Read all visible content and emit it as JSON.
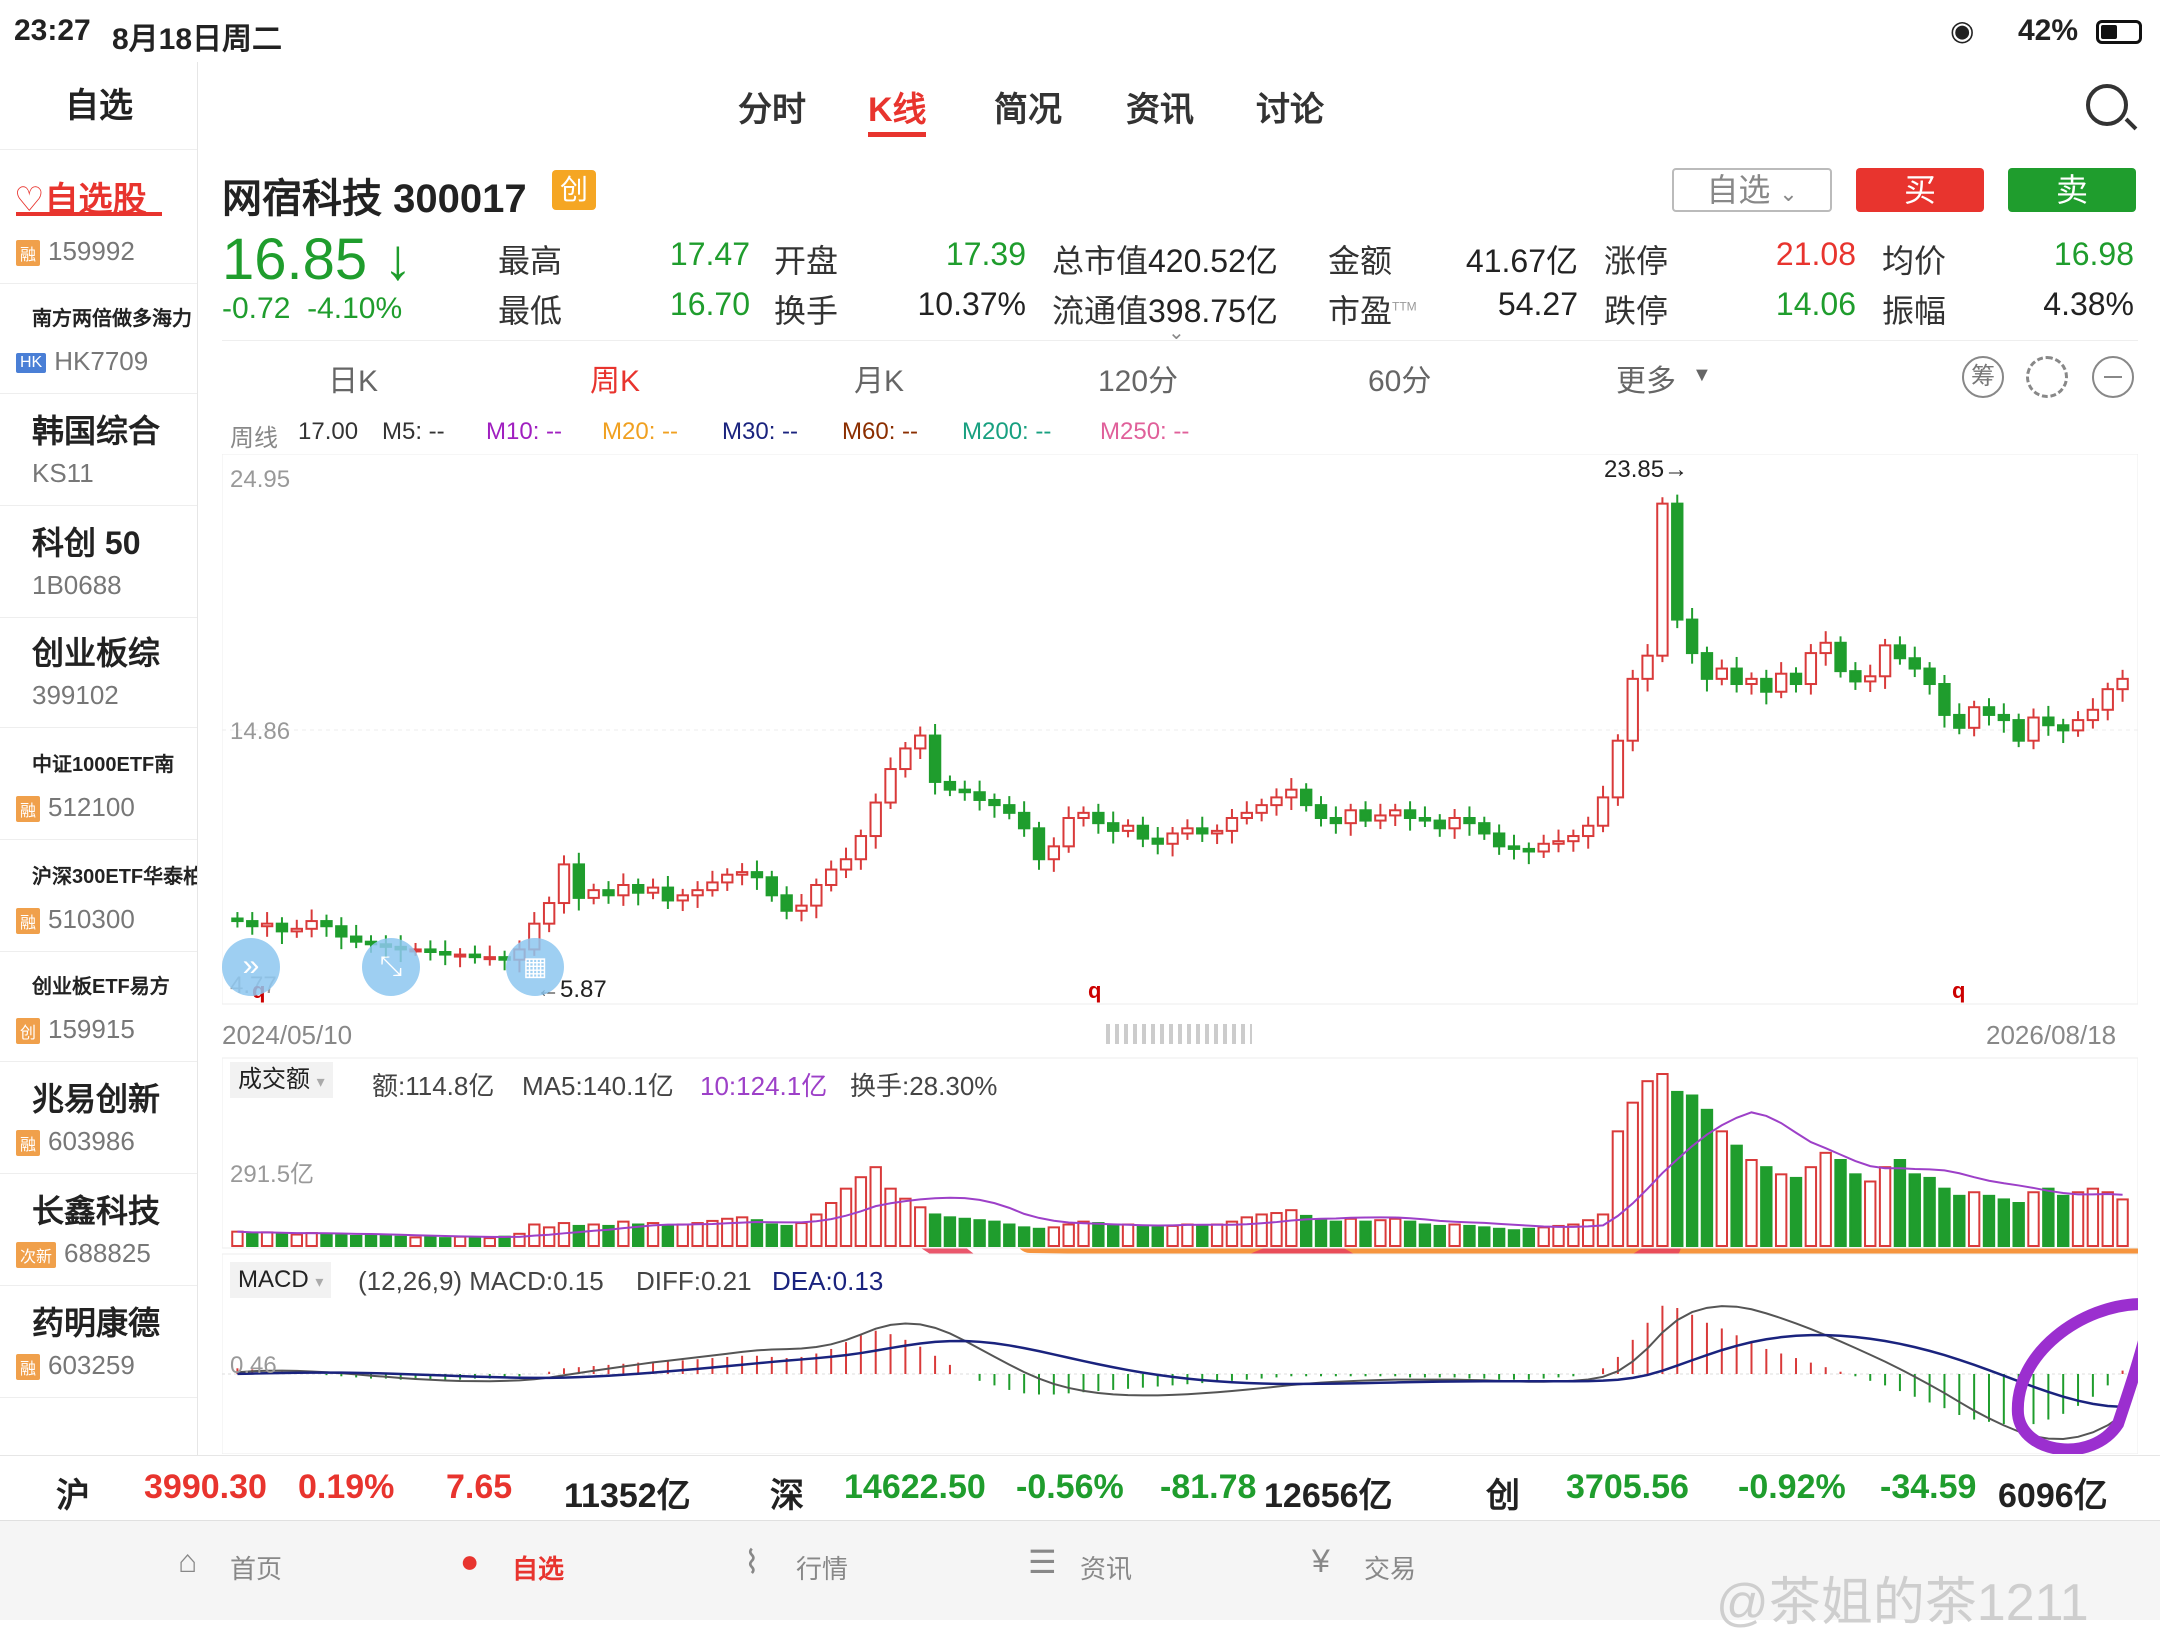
{
  "status": {
    "time": "23:27",
    "date": "8月18日周二",
    "battery": "42%"
  },
  "sidebar": {
    "title": "自选",
    "active": "自选股",
    "items": [
      {
        "name": "",
        "code": "159992",
        "badge": "融",
        "badge_color": "#f0a04b"
      },
      {
        "name": "南方两倍做多海力",
        "code": "HK7709",
        "badge": "HK",
        "badge_color": "#4a7fd6",
        "small": true
      },
      {
        "name": "韩国综合",
        "code": "KS11",
        "badge": ""
      },
      {
        "name": "科创 50",
        "code": "1B0688",
        "badge": ""
      },
      {
        "name": "创业板综",
        "code": "399102",
        "badge": ""
      },
      {
        "name": "中证1000ETF南",
        "code": "512100",
        "badge": "融",
        "badge_color": "#f0a04b",
        "small": true
      },
      {
        "name": "沪深300ETF华泰柏",
        "code": "510300",
        "badge": "融",
        "badge_color": "#f0a04b",
        "small": true
      },
      {
        "name": "创业板ETF易方",
        "code": "159915",
        "badge": "创",
        "badge_color": "#f0a04b",
        "small": true
      },
      {
        "name": "兆易创新",
        "code": "603986",
        "badge": "融",
        "badge_color": "#f0a04b"
      },
      {
        "name": "长鑫科技",
        "code": "688825",
        "badge": "次新",
        "badge_color": "#f0a04b"
      },
      {
        "name": "药明康德",
        "code": "603259",
        "badge": "融",
        "badge_color": "#f0a04b"
      }
    ]
  },
  "tabs": [
    "分时",
    "K线",
    "简况",
    "资讯",
    "讨论"
  ],
  "active_tab": "K线",
  "stock": {
    "name": "网宿科技",
    "code": "300017",
    "board": "创",
    "price": "16.85",
    "arrow": "↓",
    "change": "-0.72",
    "change_pct": "-4.10%",
    "watch_btn": "自选",
    "buy_btn": "买",
    "sell_btn": "卖",
    "fields": [
      {
        "label": "最高",
        "value": "17.47",
        "color": "green"
      },
      {
        "label": "开盘",
        "value": "17.39",
        "color": "green"
      },
      {
        "label": "总市值",
        "value": "420.52亿",
        "color": "black"
      },
      {
        "label": "金额",
        "value": "41.67亿",
        "color": "black"
      },
      {
        "label": "涨停",
        "value": "21.08",
        "color": "red"
      },
      {
        "label": "均价",
        "value": "16.98",
        "color": "green"
      },
      {
        "label": "最低",
        "value": "16.70",
        "color": "green"
      },
      {
        "label": "换手",
        "value": "10.37%",
        "color": "black"
      },
      {
        "label": "流通值",
        "value": "398.75亿",
        "color": "black"
      },
      {
        "label": "市盈",
        "sup": "TTM",
        "value": "54.27",
        "color": "black"
      },
      {
        "label": "跌停",
        "value": "14.06",
        "color": "green"
      },
      {
        "label": "振幅",
        "value": "4.38%",
        "color": "black"
      }
    ]
  },
  "periods": [
    "日K",
    "周K",
    "月K",
    "120分",
    "60分",
    "更多"
  ],
  "active_period": "周K",
  "period_icons": [
    "筹"
  ],
  "ma_line": {
    "label": "周线",
    "close": "17.00",
    "items": [
      {
        "text": "M5: --",
        "color": "#333"
      },
      {
        "text": "M10: --",
        "color": "#a020c0"
      },
      {
        "text": "M20: --",
        "color": "#f0a020"
      },
      {
        "text": "M30: --",
        "color": "#1a237e"
      },
      {
        "text": "M60: --",
        "color": "#8b2e00"
      },
      {
        "text": "M200: --",
        "color": "#18a080"
      },
      {
        "text": "M250: --",
        "color": "#e0609a"
      }
    ]
  },
  "kline": {
    "y_top": "24.95",
    "y_mid": "14.86",
    "y_bot": "4.77",
    "high_mark": "23.85→",
    "low_mark": "←5.87",
    "date_start": "2024/05/10",
    "date_end": "2026/08/18",
    "q_marks": [
      "q",
      "q",
      "q"
    ]
  },
  "volume": {
    "selector": "成交额",
    "amount": "额:114.8亿",
    "ma5": "MA5:140.1亿",
    "ma10": "10:124.1亿",
    "turnover": "换手:28.30%",
    "y_label": "291.5亿"
  },
  "macd": {
    "selector": "MACD",
    "params": "(12,26,9) MACD:0.15",
    "diff": "DIFF:0.21",
    "dea": "DEA:0.13",
    "y_label": "0.46"
  },
  "chart_data": {
    "type": "candlestick",
    "x_range": [
      "2024/05/10",
      "2026/08/18"
    ],
    "ylim": [
      4.77,
      24.95
    ],
    "high": 23.85,
    "low": 5.87,
    "closes": [
      7.6,
      7.4,
      7.5,
      7.2,
      7.3,
      7.6,
      7.4,
      7.0,
      6.8,
      6.7,
      6.6,
      6.5,
      6.5,
      6.4,
      6.3,
      6.3,
      6.2,
      6.2,
      6.1,
      6.5,
      7.5,
      8.3,
      9.8,
      8.5,
      8.8,
      8.6,
      9.0,
      8.7,
      8.9,
      8.4,
      8.6,
      8.8,
      9.1,
      9.4,
      9.5,
      9.3,
      8.6,
      8.0,
      8.2,
      9.0,
      9.6,
      10.0,
      10.9,
      12.2,
      13.5,
      14.3,
      14.8,
      13.0,
      12.7,
      12.6,
      12.3,
      12.1,
      11.8,
      11.2,
      10.0,
      10.5,
      11.6,
      11.8,
      11.4,
      11.1,
      11.3,
      10.8,
      10.6,
      11.0,
      11.2,
      11.0,
      11.1,
      11.6,
      11.8,
      12.1,
      12.4,
      12.7,
      12.1,
      11.6,
      11.4,
      11.9,
      11.5,
      11.7,
      11.9,
      11.6,
      11.5,
      11.2,
      11.6,
      11.4,
      11.0,
      10.5,
      10.4,
      10.3,
      10.6,
      10.7,
      10.9,
      11.3,
      12.4,
      14.6,
      17.0,
      17.9,
      23.8,
      19.3,
      18.0,
      17.0,
      17.4,
      16.8,
      17.0,
      16.5,
      17.2,
      16.8,
      18.0,
      18.4,
      17.3,
      16.9,
      17.1,
      18.3,
      17.8,
      17.4,
      16.8,
      15.6,
      15.1,
      15.9,
      15.6,
      15.4,
      14.6,
      15.5,
      15.2,
      15.0,
      15.4,
      15.8,
      16.6,
      17.0
    ],
    "volumes": [
      20,
      18,
      19,
      17,
      16,
      18,
      16,
      15,
      14,
      15,
      14,
      13,
      12,
      12,
      11,
      13,
      12,
      11,
      13,
      17,
      30,
      26,
      32,
      28,
      30,
      28,
      34,
      30,
      32,
      28,
      30,
      32,
      35,
      38,
      40,
      36,
      30,
      28,
      32,
      44,
      60,
      80,
      96,
      110,
      80,
      66,
      54,
      44,
      40,
      38,
      36,
      34,
      30,
      26,
      24,
      26,
      30,
      34,
      32,
      30,
      30,
      28,
      26,
      28,
      30,
      28,
      30,
      34,
      40,
      44,
      46,
      50,
      42,
      36,
      34,
      38,
      34,
      36,
      38,
      34,
      30,
      28,
      30,
      28,
      26,
      24,
      22,
      24,
      26,
      28,
      30,
      36,
      44,
      160,
      200,
      230,
      240,
      215,
      210,
      190,
      160,
      140,
      120,
      110,
      100,
      95,
      110,
      130,
      120,
      100,
      90,
      110,
      120,
      100,
      95,
      80,
      70,
      75,
      70,
      65,
      60,
      75,
      80,
      70,
      75,
      80,
      75,
      65
    ],
    "macd_hist": [
      0.05,
      0.04,
      0.03,
      0.02,
      0.01,
      0.0,
      -0.01,
      -0.02,
      -0.03,
      -0.04,
      -0.04,
      -0.05,
      -0.05,
      -0.05,
      -0.05,
      -0.05,
      -0.04,
      -0.04,
      -0.03,
      -0.02,
      0.0,
      0.02,
      0.05,
      0.06,
      0.07,
      0.08,
      0.09,
      0.1,
      0.11,
      0.11,
      0.12,
      0.13,
      0.14,
      0.15,
      0.16,
      0.16,
      0.15,
      0.14,
      0.15,
      0.18,
      0.22,
      0.28,
      0.34,
      0.38,
      0.35,
      0.3,
      0.24,
      0.16,
      0.08,
      0.0,
      -0.06,
      -0.1,
      -0.14,
      -0.17,
      -0.18,
      -0.18,
      -0.17,
      -0.16,
      -0.15,
      -0.14,
      -0.13,
      -0.12,
      -0.11,
      -0.1,
      -0.09,
      -0.08,
      -0.07,
      -0.06,
      -0.05,
      -0.04,
      -0.03,
      -0.02,
      -0.02,
      -0.02,
      -0.02,
      -0.02,
      -0.02,
      -0.02,
      -0.02,
      -0.03,
      -0.03,
      -0.03,
      -0.03,
      -0.04,
      -0.04,
      -0.05,
      -0.05,
      -0.05,
      -0.04,
      -0.03,
      -0.02,
      0.0,
      0.05,
      0.15,
      0.3,
      0.45,
      0.6,
      0.58,
      0.52,
      0.45,
      0.4,
      0.34,
      0.28,
      0.22,
      0.18,
      0.14,
      0.1,
      0.06,
      0.02,
      -0.02,
      -0.06,
      -0.1,
      -0.15,
      -0.2,
      -0.25,
      -0.3,
      -0.36,
      -0.4,
      -0.42,
      -0.44,
      -0.45,
      -0.44,
      -0.4,
      -0.35,
      -0.28,
      -0.2,
      -0.1,
      0.03
    ]
  },
  "index_bar": [
    {
      "name": "沪",
      "price": "3990.30",
      "pct": "0.19%",
      "chg": "7.65",
      "amt": "11352亿",
      "color": "red"
    },
    {
      "name": "深",
      "price": "14622.50",
      "pct": "-0.56%",
      "chg": "-81.78",
      "amt": "12656亿",
      "color": "green"
    },
    {
      "name": "创",
      "price": "3705.56",
      "pct": "-0.92%",
      "chg": "-34.59",
      "amt": "6096亿",
      "color": "green"
    }
  ],
  "nav": [
    "首页",
    "自选",
    "行情",
    "资讯",
    "交易"
  ],
  "active_nav": "自选",
  "watermark": "@茶姐的茶1211"
}
